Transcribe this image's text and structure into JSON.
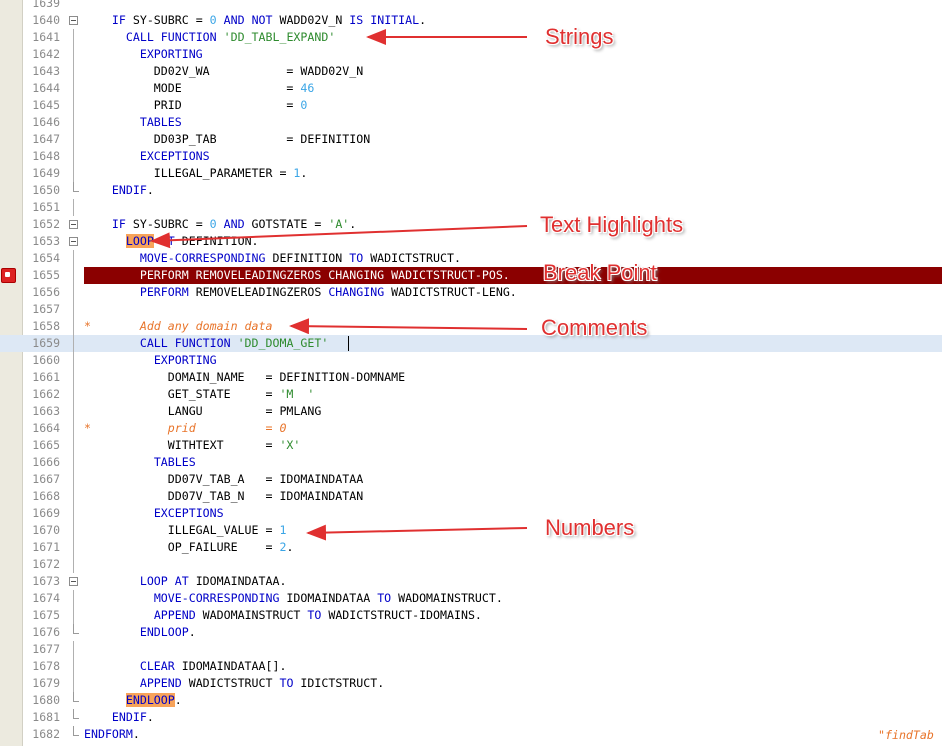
{
  "editor": {
    "lines": [
      {
        "num": "1639",
        "tokens": []
      },
      {
        "num": "1640",
        "tokens": [
          [
            "    ",
            ""
          ],
          [
            "IF",
            "kw"
          ],
          [
            " SY-SUBRC = ",
            ""
          ],
          [
            "0",
            "num"
          ],
          [
            " ",
            ""
          ],
          [
            "AND",
            "kw"
          ],
          [
            " ",
            ""
          ],
          [
            "NOT",
            "kw"
          ],
          [
            " WADD02V_N ",
            ""
          ],
          [
            "IS",
            "kw"
          ],
          [
            " ",
            ""
          ],
          [
            "INITIAL",
            "kw"
          ],
          [
            ".",
            ""
          ]
        ]
      },
      {
        "num": "1641",
        "tokens": [
          [
            "      ",
            ""
          ],
          [
            "CALL",
            "kw"
          ],
          [
            " ",
            ""
          ],
          [
            "FUNCTION",
            "kw"
          ],
          [
            " ",
            ""
          ],
          [
            "'DD_TABL_EXPAND'",
            "str"
          ]
        ]
      },
      {
        "num": "1642",
        "tokens": [
          [
            "        ",
            ""
          ],
          [
            "EXPORTING",
            "kw"
          ]
        ]
      },
      {
        "num": "1643",
        "tokens": [
          [
            "          DD02V_WA           = WADD02V_N",
            ""
          ]
        ]
      },
      {
        "num": "1644",
        "tokens": [
          [
            "          MODE               = ",
            ""
          ],
          [
            "46",
            "num"
          ]
        ]
      },
      {
        "num": "1645",
        "tokens": [
          [
            "          PRID               = ",
            ""
          ],
          [
            "0",
            "num"
          ]
        ]
      },
      {
        "num": "1646",
        "tokens": [
          [
            "        ",
            ""
          ],
          [
            "TABLES",
            "kw"
          ]
        ]
      },
      {
        "num": "1647",
        "tokens": [
          [
            "          DD03P_TAB          = DEFINITION",
            ""
          ]
        ]
      },
      {
        "num": "1648",
        "tokens": [
          [
            "        ",
            ""
          ],
          [
            "EXCEPTIONS",
            "kw"
          ]
        ]
      },
      {
        "num": "1649",
        "tokens": [
          [
            "          ILLEGAL_PARAMETER = ",
            ""
          ],
          [
            "1",
            "num"
          ],
          [
            ".",
            ""
          ]
        ]
      },
      {
        "num": "1650",
        "tokens": [
          [
            "    ",
            ""
          ],
          [
            "ENDIF",
            "kw"
          ],
          [
            ".",
            ""
          ]
        ]
      },
      {
        "num": "1651",
        "tokens": []
      },
      {
        "num": "1652",
        "tokens": [
          [
            "    ",
            ""
          ],
          [
            "IF",
            "kw"
          ],
          [
            " SY-SUBRC = ",
            ""
          ],
          [
            "0",
            "num"
          ],
          [
            " ",
            ""
          ],
          [
            "AND",
            "kw"
          ],
          [
            " GOTSTATE = ",
            ""
          ],
          [
            "'A'",
            "str"
          ],
          [
            ".",
            ""
          ]
        ]
      },
      {
        "num": "1653",
        "tokens": [
          [
            "      ",
            ""
          ],
          [
            "LOOP",
            "kw hl"
          ],
          [
            " ",
            ""
          ],
          [
            "AT",
            "kw"
          ],
          [
            " DEFINITION.",
            ""
          ]
        ]
      },
      {
        "num": "1654",
        "tokens": [
          [
            "        ",
            ""
          ],
          [
            "MOVE-CORRESPONDING",
            "kw"
          ],
          [
            " DEFINITION ",
            ""
          ],
          [
            "TO",
            "kw"
          ],
          [
            " WADICTSTRUCT.",
            ""
          ]
        ]
      },
      {
        "num": "1655",
        "tokens": [
          [
            "        PERFORM REMOVELEADINGZEROS CHANGING WADICTSTRUCT-POS.",
            ""
          ]
        ]
      },
      {
        "num": "1656",
        "tokens": [
          [
            "        ",
            ""
          ],
          [
            "PERFORM",
            "kw"
          ],
          [
            " REMOVELEADINGZEROS ",
            ""
          ],
          [
            "CHANGING",
            "kw"
          ],
          [
            " WADICTSTRUCT-LENG.",
            ""
          ]
        ]
      },
      {
        "num": "1657",
        "tokens": []
      },
      {
        "num": "1658",
        "tokens": [
          [
            "*       Add any domain data",
            "cmt"
          ]
        ]
      },
      {
        "num": "1659",
        "tokens": [
          [
            "        ",
            ""
          ],
          [
            "CALL",
            "kw"
          ],
          [
            " ",
            ""
          ],
          [
            "FUNCTION",
            "kw"
          ],
          [
            " ",
            ""
          ],
          [
            "'DD_DOMA_GET'",
            "str"
          ]
        ]
      },
      {
        "num": "1660",
        "tokens": [
          [
            "          ",
            ""
          ],
          [
            "EXPORTING",
            "kw"
          ]
        ]
      },
      {
        "num": "1661",
        "tokens": [
          [
            "            DOMAIN_NAME   = DEFINITION-DOMNAME",
            ""
          ]
        ]
      },
      {
        "num": "1662",
        "tokens": [
          [
            "            GET_STATE     = ",
            ""
          ],
          [
            "'M  '",
            "str"
          ]
        ]
      },
      {
        "num": "1663",
        "tokens": [
          [
            "            LANGU         = PMLANG",
            ""
          ]
        ]
      },
      {
        "num": "1664",
        "tokens": [
          [
            "*           prid          = 0",
            "cmt"
          ]
        ]
      },
      {
        "num": "1665",
        "tokens": [
          [
            "            WITHTEXT      = ",
            ""
          ],
          [
            "'X'",
            "str"
          ]
        ]
      },
      {
        "num": "1666",
        "tokens": [
          [
            "          ",
            ""
          ],
          [
            "TABLES",
            "kw"
          ]
        ]
      },
      {
        "num": "1667",
        "tokens": [
          [
            "            DD07V_TAB_A   = IDOMAINDATAA",
            ""
          ]
        ]
      },
      {
        "num": "1668",
        "tokens": [
          [
            "            DD07V_TAB_N   = IDOMAINDATAN",
            ""
          ]
        ]
      },
      {
        "num": "1669",
        "tokens": [
          [
            "          ",
            ""
          ],
          [
            "EXCEPTIONS",
            "kw"
          ]
        ]
      },
      {
        "num": "1670",
        "tokens": [
          [
            "            ILLEGAL_VALUE = ",
            ""
          ],
          [
            "1",
            "num"
          ]
        ]
      },
      {
        "num": "1671",
        "tokens": [
          [
            "            OP_FAILURE    = ",
            ""
          ],
          [
            "2",
            "num"
          ],
          [
            ".",
            ""
          ]
        ]
      },
      {
        "num": "1672",
        "tokens": []
      },
      {
        "num": "1673",
        "tokens": [
          [
            "        ",
            ""
          ],
          [
            "LOOP",
            "kw"
          ],
          [
            " ",
            ""
          ],
          [
            "AT",
            "kw"
          ],
          [
            " IDOMAINDATAA.",
            ""
          ]
        ]
      },
      {
        "num": "1674",
        "tokens": [
          [
            "          ",
            ""
          ],
          [
            "MOVE-CORRESPONDING",
            "kw"
          ],
          [
            " IDOMAINDATAA ",
            ""
          ],
          [
            "TO",
            "kw"
          ],
          [
            " WADOMAINSTRUCT.",
            ""
          ]
        ]
      },
      {
        "num": "1675",
        "tokens": [
          [
            "          ",
            ""
          ],
          [
            "APPEND",
            "kw"
          ],
          [
            " WADOMAINSTRUCT ",
            ""
          ],
          [
            "TO",
            "kw"
          ],
          [
            " WADICTSTRUCT-IDOMAINS.",
            ""
          ]
        ]
      },
      {
        "num": "1676",
        "tokens": [
          [
            "        ",
            ""
          ],
          [
            "ENDLOOP",
            "kw"
          ],
          [
            ".",
            ""
          ]
        ]
      },
      {
        "num": "1677",
        "tokens": []
      },
      {
        "num": "1678",
        "tokens": [
          [
            "        ",
            ""
          ],
          [
            "CLEAR",
            "kw"
          ],
          [
            " IDOMAINDATAA[].",
            ""
          ]
        ]
      },
      {
        "num": "1679",
        "tokens": [
          [
            "        ",
            ""
          ],
          [
            "APPEND",
            "kw"
          ],
          [
            " WADICTSTRUCT ",
            ""
          ],
          [
            "TO",
            "kw"
          ],
          [
            " IDICTSTRUCT.",
            ""
          ]
        ]
      },
      {
        "num": "1680",
        "tokens": [
          [
            "      ",
            ""
          ],
          [
            "ENDLOOP",
            "kw hl"
          ],
          [
            ".",
            ""
          ]
        ]
      },
      {
        "num": "1681",
        "tokens": [
          [
            "    ",
            ""
          ],
          [
            "ENDIF",
            "kw"
          ],
          [
            ".",
            ""
          ]
        ]
      },
      {
        "num": "1682",
        "tokens": [
          [
            "",
            ""
          ],
          [
            "ENDFORM",
            "kw"
          ],
          [
            ".",
            ""
          ]
        ]
      }
    ],
    "fold_open": [
      "1640",
      "1652",
      "1653",
      "1673"
    ],
    "fold_close": [
      "1650",
      "1676",
      "1680",
      "1681",
      "1682"
    ],
    "breakpoint_line": "1655",
    "current_line": "1659",
    "trailing_comment": "\"findTab"
  },
  "annotations": {
    "strings": "Strings",
    "text_highlights": "Text Highlights",
    "break_point": "Break Point",
    "comments": "Comments",
    "numbers": "Numbers"
  },
  "colors": {
    "keyword": "#0000c8",
    "string": "#2e8b2e",
    "number": "#3aa5e6",
    "comment": "#e8742a",
    "highlight": "#f7a35a",
    "breakpoint": "#8b0000",
    "annotation": "#e03030"
  }
}
